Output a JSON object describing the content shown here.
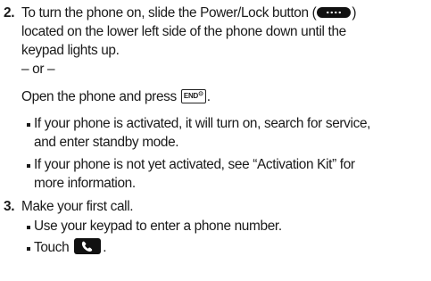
{
  "steps": [
    {
      "number": "2.",
      "lines": [
        "To turn the phone on, slide the Power/Lock button (",
        ")",
        "located on the lower left side of the phone down until the",
        "keypad lights up."
      ],
      "or_text": "– or –",
      "alt_before": "Open the phone and press",
      "alt_after": ".",
      "bullets": [
        {
          "lines": [
            "If your phone is activated, it will turn on, search for service,",
            "and enter standby mode."
          ]
        },
        {
          "lines": [
            "If your phone is not yet activated, see “Activation Kit” for",
            "more information."
          ]
        }
      ]
    },
    {
      "number": "3.",
      "text": "Make your first call.",
      "bullets": [
        {
          "text": "Use your keypad to enter a phone number."
        },
        {
          "text_before": "Touch",
          "text_after": "."
        }
      ]
    }
  ],
  "keys": {
    "end_label": "END",
    "end_superscript": "⊙",
    "power_button_icon": "power-lock-button-icon",
    "talk_key_icon": "talk-key-icon"
  }
}
